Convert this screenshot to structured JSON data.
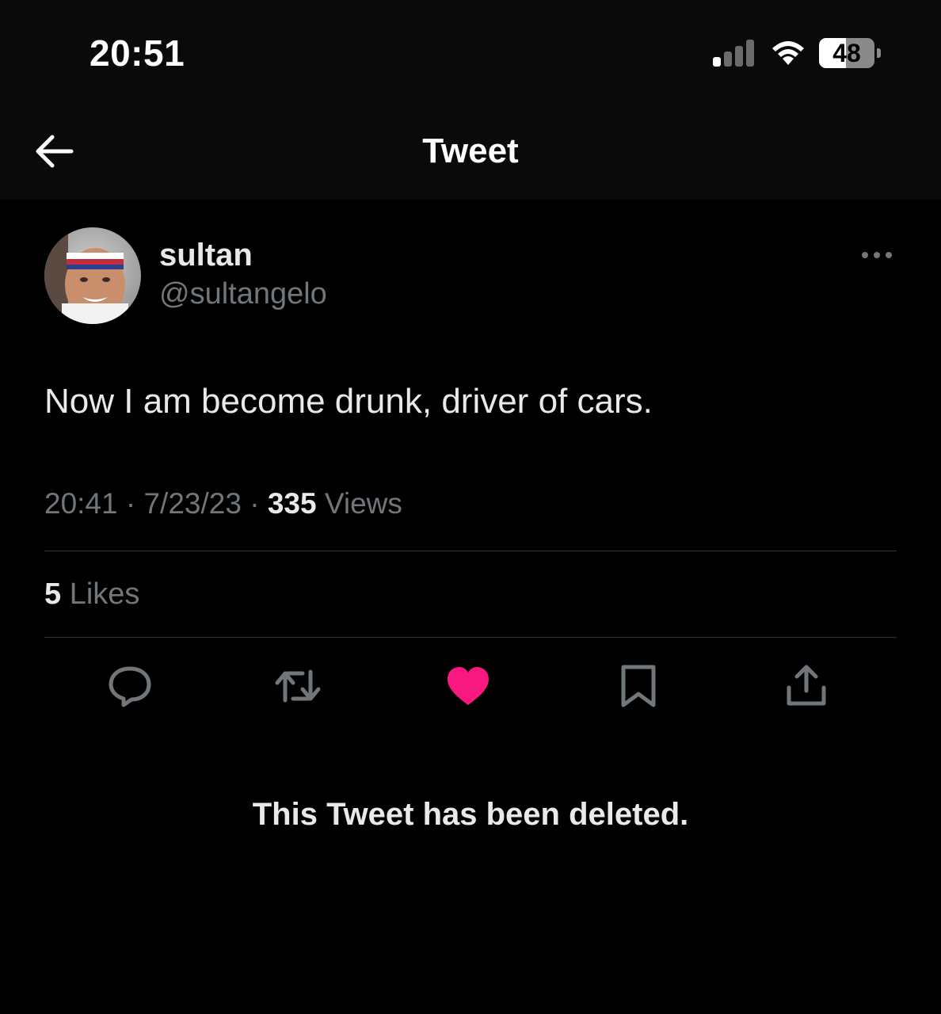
{
  "status_bar": {
    "time": "20:51",
    "battery_level": "48",
    "signal_bars_active": 1,
    "signal_bars_total": 4
  },
  "header": {
    "title": "Tweet",
    "back_icon": "arrow-left-icon"
  },
  "tweet": {
    "author": {
      "display_name": "sultan",
      "handle": "@sultangelo"
    },
    "text": "Now I am become drunk, driver of cars.",
    "time": "20:41",
    "separator": " · ",
    "date": "7/23/23",
    "views_count": "335",
    "views_label": " Views",
    "likes_count": "5",
    "likes_label": " Likes"
  },
  "actions": [
    {
      "name": "reply",
      "icon": "reply-icon"
    },
    {
      "name": "retweet",
      "icon": "retweet-icon"
    },
    {
      "name": "like",
      "icon": "heart-icon",
      "active": true
    },
    {
      "name": "bookmark",
      "icon": "bookmark-icon"
    },
    {
      "name": "share",
      "icon": "share-icon"
    }
  ],
  "notice": "This Tweet has been deleted.",
  "colors": {
    "background": "#000000",
    "text_primary": "#e7e9ea",
    "text_secondary": "#71767b",
    "divider": "#2f3336",
    "like_active": "#f91880"
  }
}
